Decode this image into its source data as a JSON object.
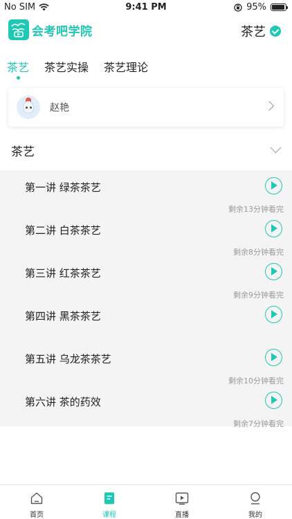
{
  "status_bar": {
    "carrier": "No SIM",
    "time": "9:41 PM",
    "battery_pct": "95%",
    "battery_level": 0.95
  },
  "header": {
    "logo_icon": "app-logo-icon",
    "brand": "会考吧学院",
    "subject": "茶艺"
  },
  "tabs": [
    {
      "label": "茶艺",
      "active": true
    },
    {
      "label": "茶艺实操",
      "active": false
    },
    {
      "label": "茶艺理论",
      "active": false
    }
  ],
  "teacher": {
    "name": "赵艳"
  },
  "section": {
    "title": "茶艺"
  },
  "lessons": [
    {
      "title": "第一讲 绿茶茶艺",
      "remaining": "剩余13分钟看完"
    },
    {
      "title": "第二讲 白茶茶艺",
      "remaining": "剩余8分钟看完"
    },
    {
      "title": "第三讲 红茶茶艺",
      "remaining": "剩余9分钟看完"
    },
    {
      "title": "第四讲 黑茶茶艺",
      "remaining": ""
    },
    {
      "title": "第五讲 乌龙茶茶艺",
      "remaining": "剩余10分钟看完"
    },
    {
      "title": "第六讲 茶的药效",
      "remaining": "剩余7分钟看完"
    }
  ],
  "bottom_nav": [
    {
      "label": "首页",
      "icon": "home-icon",
      "active": false
    },
    {
      "label": "课程",
      "icon": "course-icon",
      "active": true
    },
    {
      "label": "直播",
      "icon": "live-icon",
      "active": false
    },
    {
      "label": "我的",
      "icon": "profile-icon",
      "active": false
    }
  ],
  "colors": {
    "accent": "#1fc8b5",
    "list_background": "#f4f4f4",
    "muted_text": "#9a9a9a"
  }
}
